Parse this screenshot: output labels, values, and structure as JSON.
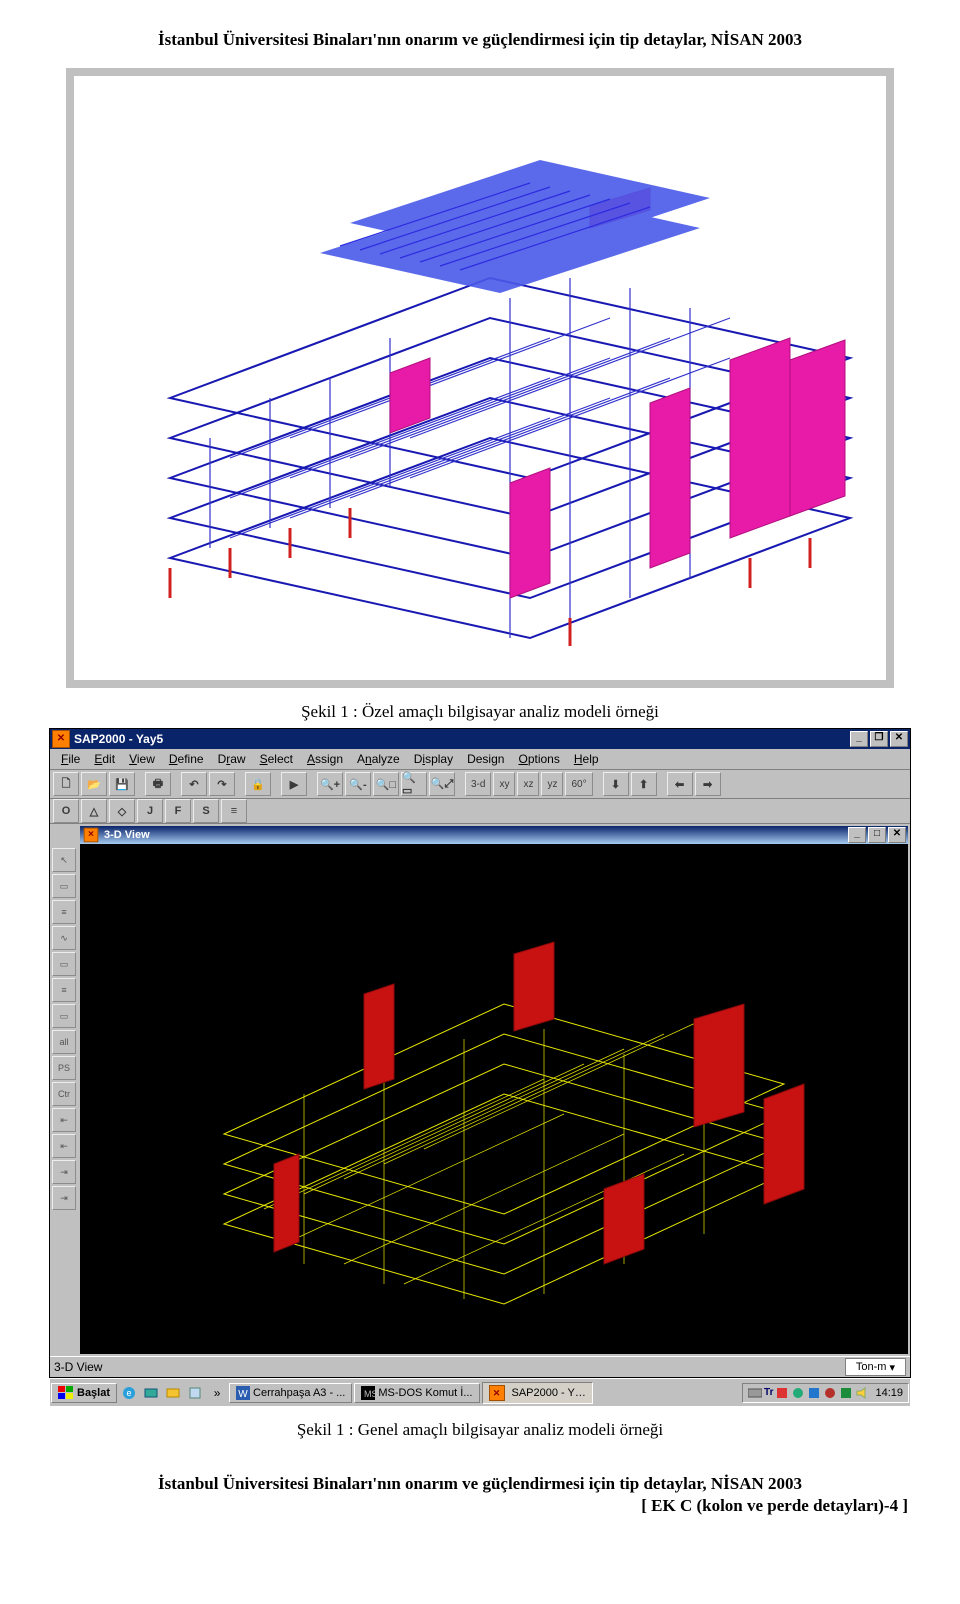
{
  "header": "İstanbul Üniversitesi Binaları'nın onarım ve güçlendirmesi için tip detaylar,  NİSAN 2003",
  "caption1": "Şekil 1 : Özel amaçlı bilgisayar analiz modeli örneği",
  "caption2": "Şekil 1 : Genel amaçlı bilgisayar analiz modeli örneği",
  "footer": "İstanbul Üniversitesi Binaları'nın onarım ve güçlendirmesi için tip detaylar,  NİSAN 2003",
  "footer_right": "[ EK C (kolon ve perde detayları)-4 ]",
  "sap": {
    "app_title": "SAP2000 - Yay5",
    "menus": [
      "File",
      "Edit",
      "View",
      "Define",
      "Draw",
      "Select",
      "Assign",
      "Analyze",
      "Display",
      "Design",
      "Options",
      "Help"
    ],
    "toolbar1": [
      "new",
      "open",
      "save",
      "|",
      "print",
      "|",
      "undo",
      "redo",
      "|",
      "lock",
      "|",
      "run",
      "|",
      "zoom-in",
      "zoom-out",
      "zoom-sel",
      "zoom-window",
      "zoom-all",
      "|"
    ],
    "toolbar1_right": [
      "3-d",
      "xy",
      "xz",
      "yz",
      "60°",
      "|",
      "↓",
      "↑",
      "|",
      "←",
      "→"
    ],
    "toolbar2": [
      "O",
      "△",
      "◇",
      "J",
      "F",
      "S",
      "≡"
    ],
    "sidebar": [
      "▲",
      "□",
      "≡",
      "∿",
      "□",
      "≡",
      "□",
      "all",
      "PS",
      "Ctr",
      "-|◄",
      "-|◄",
      "►|-",
      "►|-"
    ],
    "view_title": "3-D View",
    "status_left": "3-D View",
    "status_unit": "Ton-m"
  },
  "taskbar": {
    "start": "Başlat",
    "tasks": [
      {
        "label": "Cerrahpaşa A3 - ...",
        "icon": "word"
      },
      {
        "label": "MS-DOS Komut İ...",
        "icon": "dos"
      },
      {
        "label": "SAP2000 - Y…",
        "icon": "sap",
        "pressed": true
      }
    ],
    "tray_icons": [
      "kb",
      "Tr",
      "d1",
      "d2",
      "d3",
      "d4",
      "d5",
      "vol"
    ],
    "clock": "14:19",
    "chev": "»"
  }
}
